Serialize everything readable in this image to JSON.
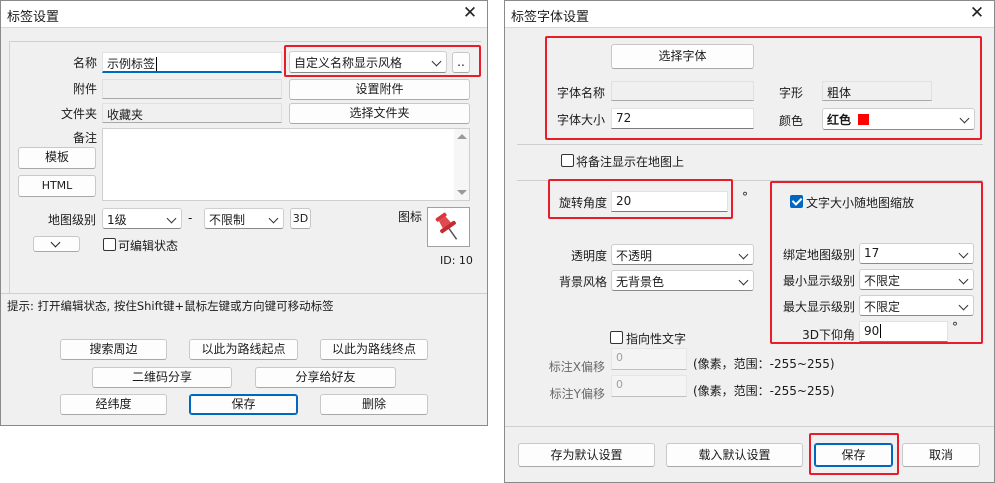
{
  "left_dialog": {
    "title": "标签设置",
    "name_label": "名称",
    "name_value": "示例标签",
    "style_select": "自定义名称显示风格",
    "more_button": "..",
    "attach_label": "附件",
    "attach_button": "设置附件",
    "folder_label": "文件夹",
    "folder_value": "收藏夹",
    "folder_button": "选择文件夹",
    "note_label": "备注",
    "template_button": "模板",
    "html_button": "HTML",
    "map_level_label": "地图级别",
    "level_min": "1级",
    "level_dash": "-",
    "level_max": "不限制",
    "btn_3d": "3D",
    "icon_label": "图标",
    "icon_id": "ID: 10",
    "editable_label": "可编辑状态",
    "hint": "提示: 打开编辑状态, 按住Shift键+鼠标左键或方向键可移动标签",
    "buttons": {
      "search_nearby": "搜索周边",
      "route_start": "以此为路线起点",
      "route_end": "以此为路线终点",
      "qr_share": "二维码分享",
      "share_friend": "分享给好友",
      "latlng": "经纬度",
      "save": "保存",
      "delete": "删除"
    }
  },
  "right_dialog": {
    "title": "标签字体设置",
    "choose_font_button": "选择字体",
    "font_name_label": "字体名称",
    "font_name_value": "",
    "font_style_label": "字形",
    "font_style_value": "粗体",
    "font_size_label": "字体大小",
    "font_size_value": "72",
    "color_label": "颜色",
    "color_value": "红色",
    "color_swatch": "#ff0000",
    "show_note_label": "将备注显示在地图上",
    "rotation_label": "旋转角度",
    "rotation_value": "20",
    "degree": "°",
    "scale_with_map_label": "文字大小随地图缩放",
    "transparency_label": "透明度",
    "transparency_value": "不透明",
    "bg_style_label": "背景风格",
    "bg_style_value": "无背景色",
    "bind_level_label": "绑定地图级别",
    "bind_level_value": "17",
    "min_level_label": "最小显示级别",
    "min_level_value": "不限定",
    "max_level_label": "最大显示级别",
    "max_level_value": "不限定",
    "pitch_label": "3D下仰角",
    "pitch_value": "90",
    "directional_label": "指向性文字",
    "x_offset_label": "标注X偏移",
    "x_offset_value": "0",
    "y_offset_label": "标注Y偏移",
    "y_offset_value": "0",
    "offset_hint": "(像素，范围：-255~255)",
    "save_default_button": "存为默认设置",
    "load_default_button": "载入默认设置",
    "save_button": "保存",
    "cancel_button": "取消"
  },
  "colors": {
    "highlight": "#e81c2a",
    "accent": "#0067c0",
    "pin": "#d9353a"
  }
}
